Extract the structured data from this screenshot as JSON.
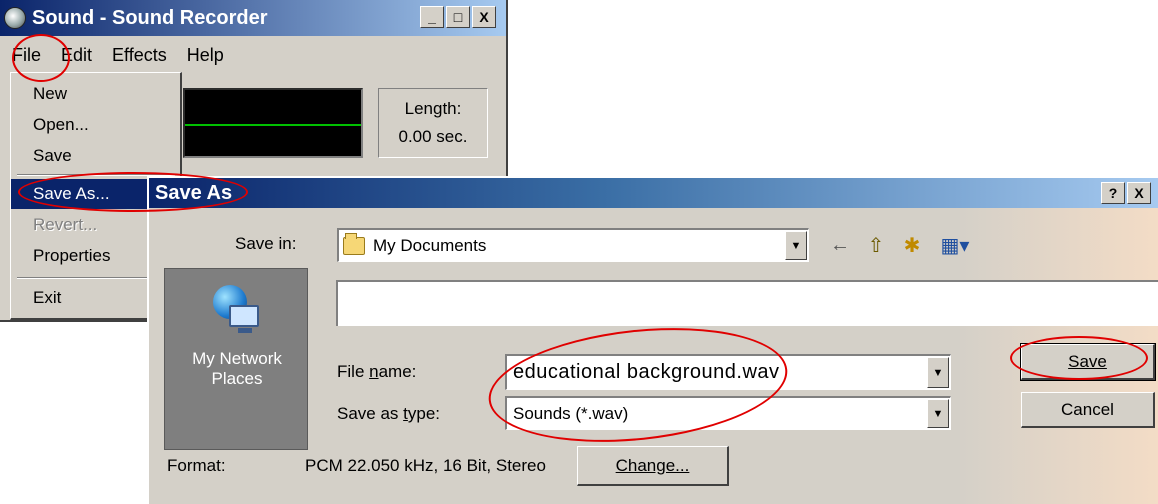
{
  "recorder": {
    "title": "Sound - Sound Recorder",
    "window_buttons": [
      "_",
      "□",
      "X"
    ],
    "menu": [
      "File",
      "Edit",
      "Effects",
      "Help"
    ],
    "length_label": "Length:",
    "length_value": "0.00 sec."
  },
  "file_menu": {
    "items": [
      "New",
      "Open...",
      "Save",
      "Save As...",
      "Revert...",
      "Properties",
      "Exit"
    ],
    "highlighted": "Save As...",
    "disabled": [
      "Revert..."
    ]
  },
  "save_dialog": {
    "title": "Save As",
    "title_buttons": [
      "?",
      "X"
    ],
    "save_in_label": "Save in:",
    "save_in_value": "My Documents",
    "toolbar_icons": [
      "back-icon",
      "up-folder-icon",
      "new-folder-icon",
      "view-menu-icon"
    ],
    "toolbar_glyphs": [
      "←",
      "⇧",
      "✱",
      "▦▾"
    ],
    "places": [
      "My Network Places"
    ],
    "file_name_label": "File name:",
    "file_name_value": "educational background.wav",
    "save_type_label": "Save as type:",
    "save_type_value": "Sounds (*.wav)",
    "save_button": "Save",
    "cancel_button": "Cancel",
    "format_label": "Format:",
    "format_value": "PCM 22.050 kHz, 16 Bit, Stereo",
    "change_button": "Change..."
  },
  "colors": {
    "title_bar": "#0a246a",
    "face": "#d4d0c8",
    "annotation": "#e00000",
    "waveform_line": "#00c000"
  }
}
